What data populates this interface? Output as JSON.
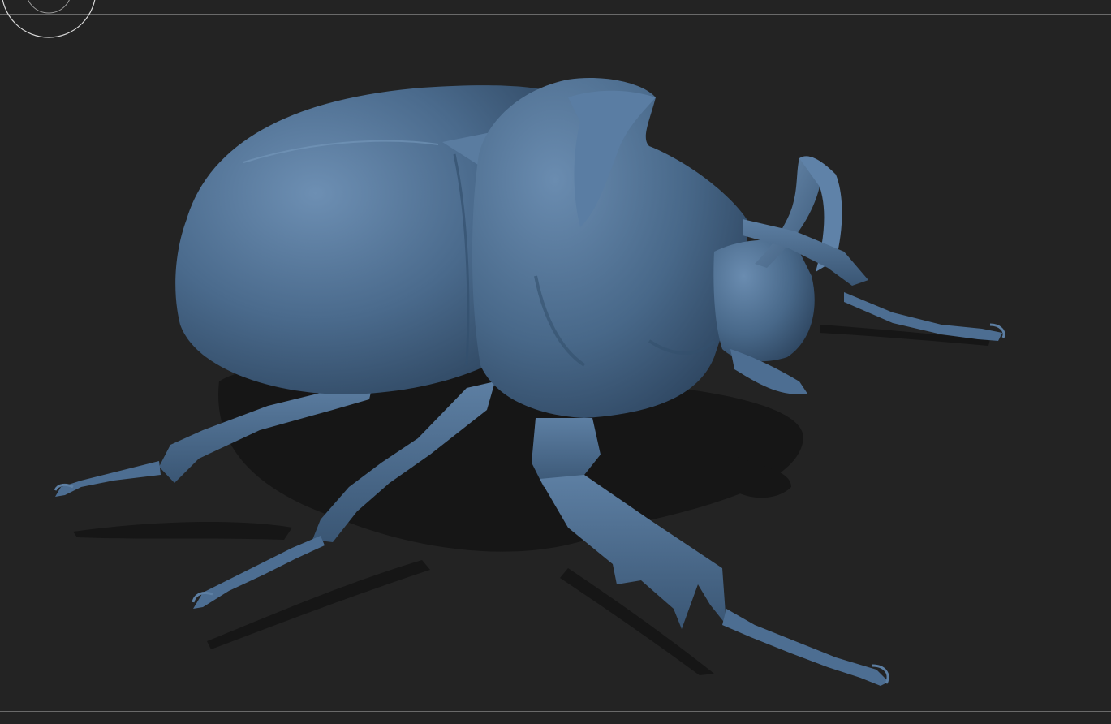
{
  "viewport": {
    "background": "#232323",
    "guide_line_color": "#6a6a6a",
    "gizmo_color": "#d8d8d8"
  },
  "model": {
    "subject": "rhinoceros-beetle",
    "material_color": "#4a6a8c",
    "highlight_color": "#6d8fb3",
    "shadow_color": "#2e4660",
    "ground_shadow_color": "#161616"
  }
}
